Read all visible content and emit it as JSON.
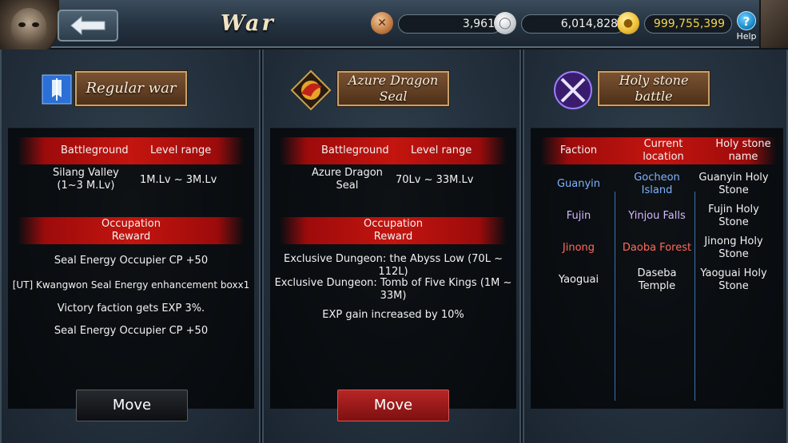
{
  "header": {
    "title": "War",
    "back_icon": "back-arrow-icon",
    "help_label": "Help",
    "help_glyph": "?",
    "currencies": [
      {
        "name": "bronze-coin-icon",
        "value": "3,961",
        "color": "#c07a42"
      },
      {
        "name": "silver-coin-icon",
        "value": "6,014,828",
        "color": "#c8ccd0"
      },
      {
        "name": "gold-coin-icon",
        "value": "999,755,399",
        "color": "#f0c23a"
      }
    ]
  },
  "panels": [
    {
      "title": "Regular war",
      "icon": "banner-flag-icon",
      "table_headers": [
        "Battleground",
        "Level range"
      ],
      "battleground": "Silang Valley\n(1~3 M.Lv)",
      "level_range": "1M.Lv ~ 3M.Lv",
      "reward_header": "Occupation\nReward",
      "rewards": [
        "Seal Energy Occupier CP +50",
        "[UT] Kwangwon Seal Energy enhancement boxx1",
        "Victory faction gets EXP 3%.",
        "Seal Energy Occupier CP +50"
      ],
      "move_label": "Move"
    },
    {
      "title": "Azure Dragon\nSeal",
      "icon": "azure-dragon-icon",
      "table_headers": [
        "Battleground",
        "Level range"
      ],
      "battleground": "Azure Dragon\nSeal",
      "level_range": "70Lv ~ 33M.Lv",
      "reward_header": "Occupation\nReward",
      "rewards": [
        "Exclusive Dungeon: the Abyss Low (70L ~\n112L)",
        "Exclusive Dungeon: Tomb of Five Kings (1M ~\n33M)",
        "EXP gain increased by 10%"
      ],
      "move_label": "Move"
    },
    {
      "title": "Holy stone\nbattle",
      "icon": "crossed-swords-icon",
      "table_headers": [
        "Faction",
        "Current\nlocation",
        "Holy stone\nname"
      ],
      "rows": [
        {
          "faction": "Guanyin",
          "location": "Gocheon\nIsland",
          "stone": "Guanyin Holy\nStone",
          "faction_color": "#7fb3ff",
          "location_color": "#7fb3ff"
        },
        {
          "faction": "Fujin",
          "location": "Yinjou Falls",
          "stone": "Fujin Holy\nStone",
          "faction_color": "#d9b7ff",
          "location_color": "#d9b7ff"
        },
        {
          "faction": "Jinong",
          "location": "Daoba Forest",
          "stone": "Jinong Holy\nStone",
          "faction_color": "#ff6a5c",
          "location_color": "#ff6a5c"
        },
        {
          "faction": "Yaoguai",
          "location": "Daseba\nTemple",
          "stone": "Yaoguai Holy\nStone",
          "faction_color": "#ffffff",
          "location_color": "#ffffff"
        }
      ]
    }
  ]
}
